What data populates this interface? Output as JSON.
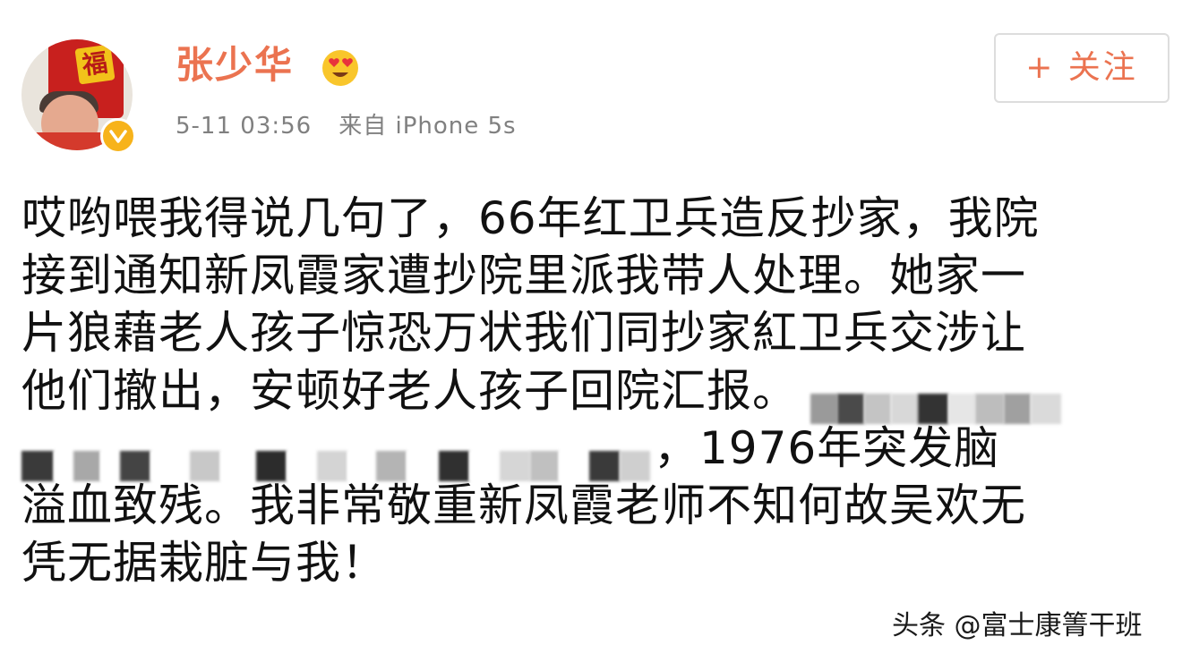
{
  "user": {
    "name": "张少华",
    "emoji": "heart-eyes-emoji",
    "verified": true,
    "avatar_poster_char": "福"
  },
  "post": {
    "time": "5-11 03:56",
    "source": "来自 iPhone 5s",
    "lines": [
      "哎哟喂我得说几句了，66年红卫兵造反抄家，我院",
      "接到通知新凤霞家遭抄院里派我带人处理。她家一",
      "片狼藉老人孩子惊恐万状我们同抄家紅卫兵交涉让",
      "他们撤出，安顿好老人孩子回院汇报。",
      "，1976年突发脑",
      "溢血致残。我非常敬重新凤霞老师不知何故吴欢无",
      "凭无据栽脏与我！"
    ]
  },
  "follow_button": {
    "label": "+ 关注"
  },
  "watermark": "头条 @富士康箐干班",
  "colors": {
    "accent": "#eb7350",
    "meta_text": "#808080",
    "badge": "#f7b31b"
  }
}
